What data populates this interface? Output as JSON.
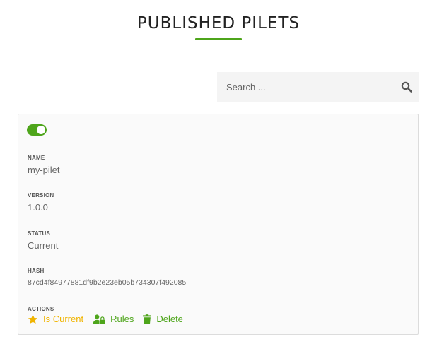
{
  "header": {
    "title": "PUBLISHED PILETS"
  },
  "search": {
    "placeholder": "Search ...",
    "icon": "search-icon"
  },
  "pilet": {
    "enabled": true,
    "fields": {
      "name_label": "NAME",
      "name_value": "my-pilet",
      "version_label": "VERSION",
      "version_value": "1.0.0",
      "status_label": "STATUS",
      "status_value": "Current",
      "hash_label": "HASH",
      "hash_value": "87cd4f84977881df9b2e23eb05b734307f492085"
    },
    "actions_label": "ACTIONS",
    "actions": {
      "is_current": "Is Current",
      "rules": "Rules",
      "delete": "Delete"
    }
  },
  "colors": {
    "accent": "#4ea51b",
    "current": "#f0b400"
  }
}
